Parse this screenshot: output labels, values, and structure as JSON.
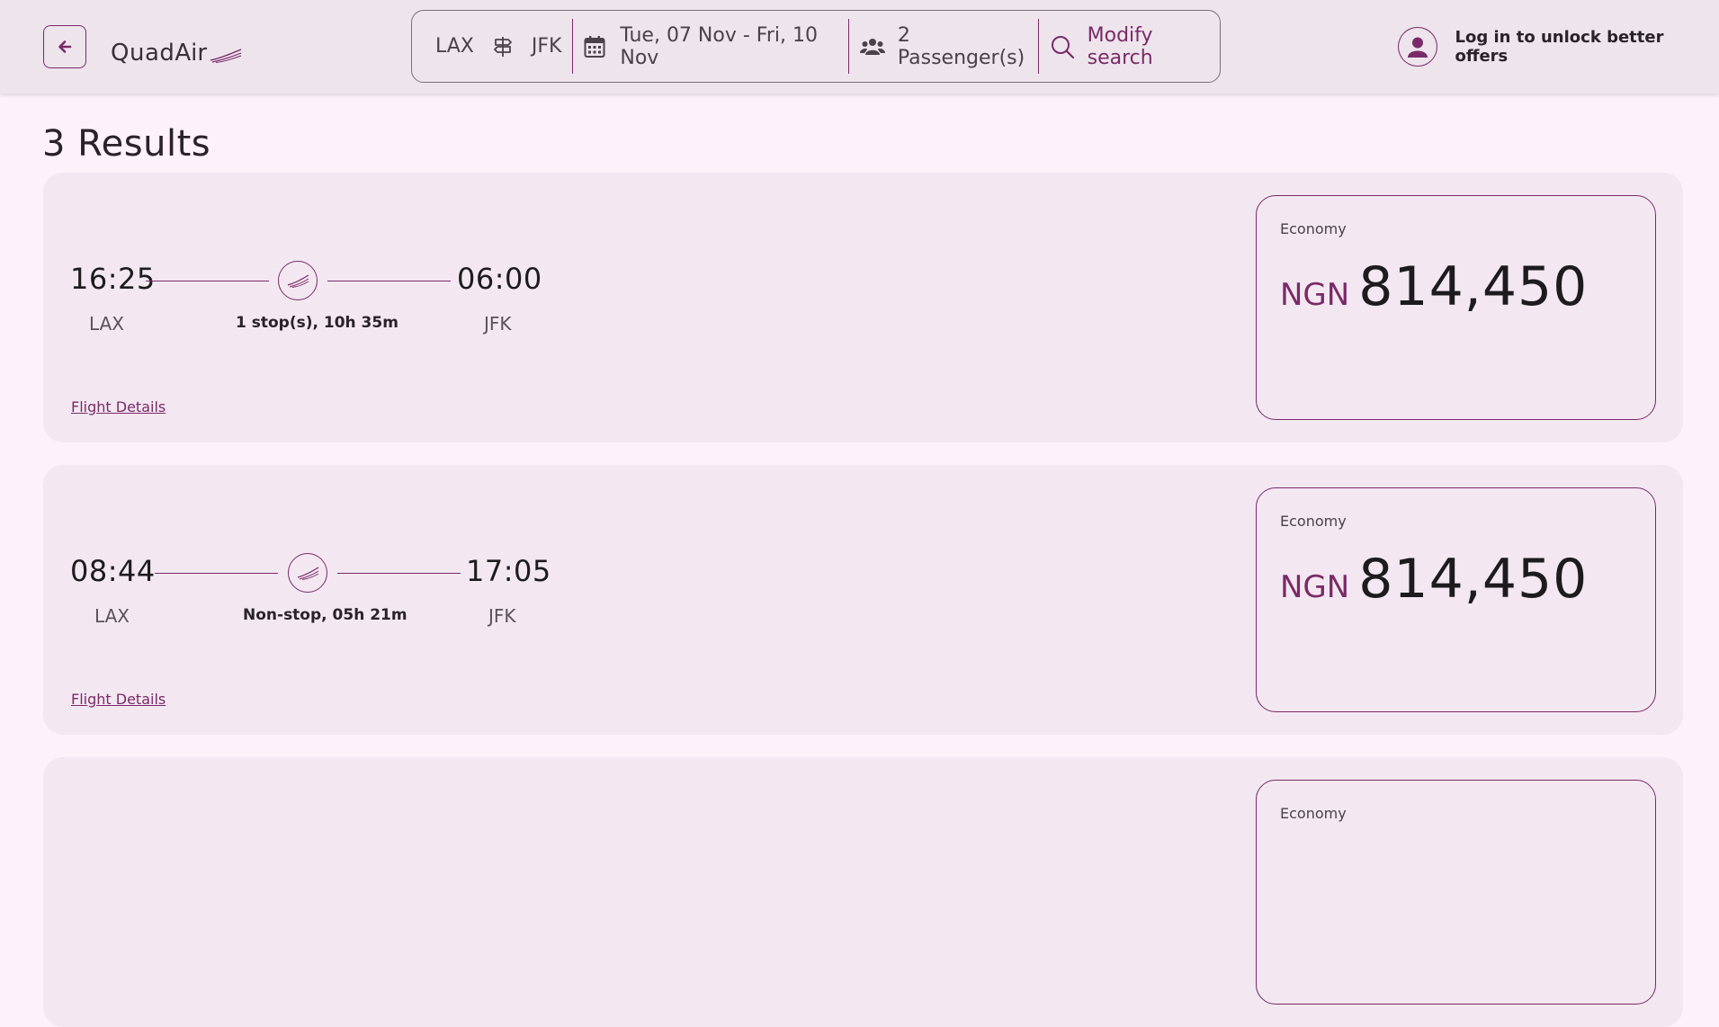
{
  "header": {
    "logo_quad": "Quad",
    "logo_air": "Air",
    "search": {
      "origin": "LAX",
      "destination": "JFK",
      "dates": "Tue, 07 Nov - Fri, 10 Nov",
      "passengers": "2 Passenger(s)",
      "modify_label": "Modify search"
    },
    "login_label": "Log in to unlock better offers"
  },
  "results_title": "3 Results",
  "flights": [
    {
      "depart_time": "16:25",
      "arrive_time": "06:00",
      "origin": "LAX",
      "destination": "JFK",
      "duration": "1 stop(s), 10h 35m",
      "details_label": "Flight Details",
      "fare_class": "Economy",
      "currency": "NGN",
      "price": "814,450"
    },
    {
      "depart_time": "08:44",
      "arrive_time": "17:05",
      "origin": "LAX",
      "destination": "JFK",
      "duration": "Non-stop, 05h 21m",
      "details_label": "Flight Details",
      "fare_class": "Economy",
      "currency": "NGN",
      "price": "814,450"
    },
    {
      "fare_class": "Economy"
    }
  ],
  "colors": {
    "accent": "#7a2a68",
    "background": "#fdf1fa",
    "card": "#f3e8f1",
    "header": "#ede4ec"
  },
  "icons": {
    "back": "arrow-left-icon",
    "route": "signpost-icon",
    "calendar": "calendar-icon",
    "passengers": "users-icon",
    "search": "search-icon",
    "user": "user-icon",
    "plane": "airline-logo-icon"
  }
}
